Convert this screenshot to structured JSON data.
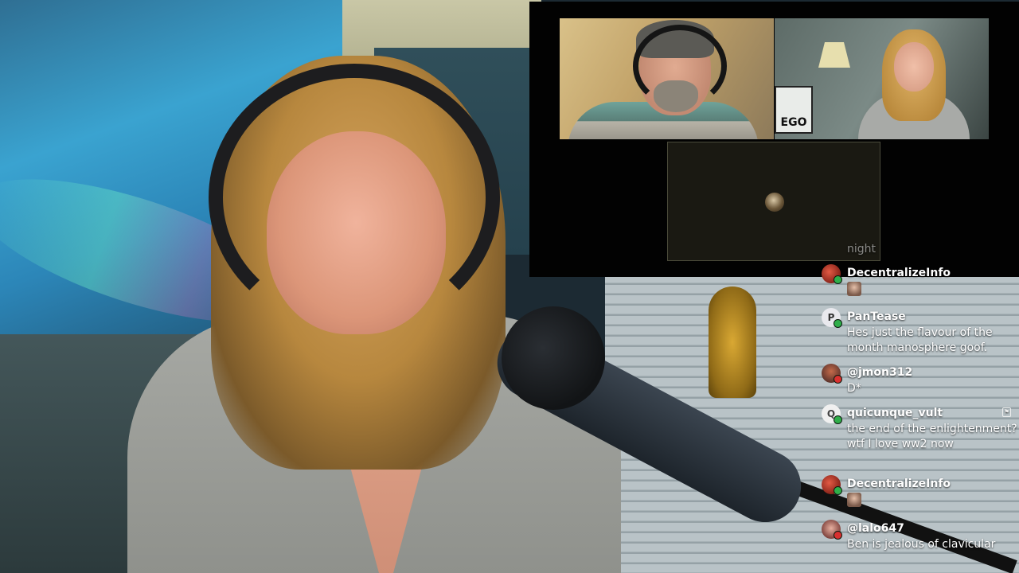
{
  "call": {
    "tiles": [
      {
        "role": "host"
      },
      {
        "role": "guest",
        "sign_text": "EGO"
      },
      {
        "role": "empty"
      }
    ]
  },
  "chat": {
    "faded_text": "night",
    "messages": [
      {
        "username": "DecentralizeInfo",
        "type": "sticker",
        "text": "",
        "badge": "green"
      },
      {
        "username": "PanTease",
        "type": "text",
        "text": "Hes just the flavour of the month manosphere goof.",
        "avatar_letter": "P",
        "badge": "green"
      },
      {
        "username": "@jmon312",
        "type": "text",
        "text": "D*",
        "badge": "red"
      },
      {
        "username": "quicunque_vult",
        "type": "text",
        "text": "the end of the enlightenment? wtf I love ww2 now",
        "avatar_letter": "Q",
        "badge": "green"
      },
      {
        "username": "DecentralizeInfo",
        "type": "sticker",
        "text": "",
        "badge": "green"
      },
      {
        "username": "@lalo647",
        "type": "text",
        "text": "Ben is jealous of clavicular",
        "badge": "red"
      }
    ]
  },
  "colors": {
    "chat_text": "#ffffff",
    "badge_green": "#2fae4a",
    "badge_red": "#d9302f",
    "call_bg": "#020202"
  }
}
